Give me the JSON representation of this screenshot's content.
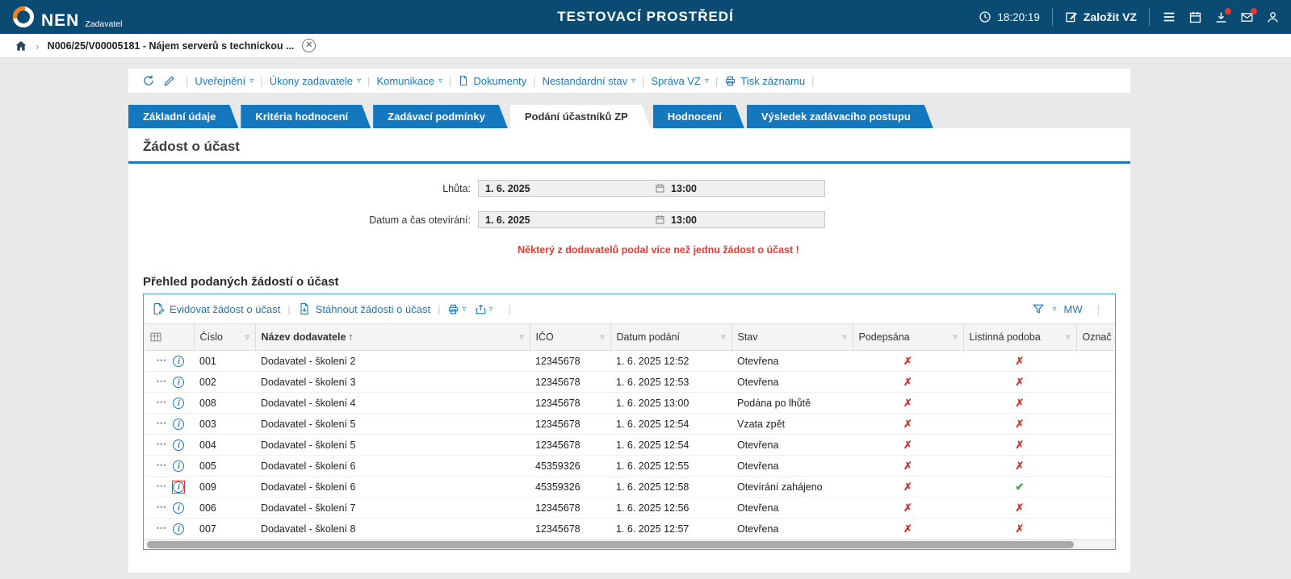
{
  "colors": {
    "header-bg": "#0a4b74",
    "tab-blue": "#1478be",
    "link-blue": "#1b78c2",
    "warning-red": "#e23b32",
    "mark-red": "#d23430",
    "mark-green": "#3fae49",
    "panel-border": "#44a2d9",
    "badge-red": "#e53935"
  },
  "icons": {
    "logo": "orange-white-ring",
    "clock-icon": "🕐",
    "create-vz-icon": "✎▢",
    "menu-icon": "≡",
    "calendar-icon": "▦",
    "download-icon": "⤓",
    "mail-icon": "✉",
    "user-icon": "👤",
    "home-icon": "⌂",
    "close-icon": "⊗",
    "refresh-icon": "⟲",
    "pencil-icon": "✎",
    "document-icon": "🗎",
    "printer-icon": "⎙",
    "export-icon": "↥",
    "filter-icon": "▼",
    "caret": "▿",
    "sort-asc": "↑",
    "row-menu-icon": "•••",
    "info-icon": "ⓘ",
    "cross-mark": "✗",
    "check-mark": "✔"
  },
  "header": {
    "brand": "NEN",
    "role": "Zadavatel",
    "title": "TESTOVACÍ PROSTŘEDÍ",
    "time": "18:20:19",
    "create_vz_label": "Založit VZ"
  },
  "breadcrumb": {
    "chevron": "›",
    "record": "N006/25/V00005181 - Nájem serverů s technickou ...",
    "close": "✕"
  },
  "record_toolbar": {
    "items": [
      {
        "label": "Uveřejnění"
      },
      {
        "label": "Úkony zadavatele"
      },
      {
        "label": "Komunikace"
      },
      {
        "label": "Dokumenty"
      },
      {
        "label": "Nestandardní stav"
      },
      {
        "label": "Správa VZ"
      },
      {
        "label": "Tisk záznamu"
      }
    ]
  },
  "tabs": [
    {
      "label": "Základní údaje",
      "active": false
    },
    {
      "label": "Kritéria hodnocení",
      "active": false
    },
    {
      "label": "Zadávací podmínky",
      "active": false
    },
    {
      "label": "Podání účastníků ZP",
      "active": true
    },
    {
      "label": "Hodnocení",
      "active": false
    },
    {
      "label": "Výsledek zadávacího postupu",
      "active": false
    }
  ],
  "request_section": {
    "title": "Žádost o účast",
    "fields": [
      {
        "label": "Lhůta:",
        "date": "1. 6. 2025",
        "time": "13:00"
      },
      {
        "label": "Datum a čas otevírání:",
        "date": "1. 6. 2025",
        "time": "13:00"
      }
    ],
    "warning": "Některý z dodavatelů podal více než jednu žádost o účast !"
  },
  "grid": {
    "title": "Přehled podaných žádostí o účast",
    "toolbar": {
      "evidovat": "Evidovat žádost o účast",
      "stahnout": "Stáhnout žádosti o účast",
      "mw": "MW"
    },
    "columns": {
      "cislo": "Číslo",
      "nazev": "Název dodavatele",
      "ico": "IČO",
      "datum": "Datum podání",
      "stav": "Stav",
      "podepsana": "Podepsána",
      "listinna": "Listinná podoba",
      "oznac": "Označ"
    },
    "rows": [
      {
        "cislo": "001",
        "nazev": "Dodavatel - školení 2",
        "ico": "12345678",
        "datum": "1. 6. 2025 12:52",
        "stav": "Otevřena",
        "podepsana": false,
        "listinna": false,
        "info_highlighted": false
      },
      {
        "cislo": "002",
        "nazev": "Dodavatel - školení 3",
        "ico": "12345678",
        "datum": "1. 6. 2025 12:53",
        "stav": "Otevřena",
        "podepsana": false,
        "listinna": false,
        "info_highlighted": false
      },
      {
        "cislo": "008",
        "nazev": "Dodavatel - školení 4",
        "ico": "12345678",
        "datum": "1. 6. 2025 13:00",
        "stav": "Podána po lhůtě",
        "podepsana": false,
        "listinna": false,
        "info_highlighted": false
      },
      {
        "cislo": "003",
        "nazev": "Dodavatel - školení 5",
        "ico": "12345678",
        "datum": "1. 6. 2025 12:54",
        "stav": "Vzata zpět",
        "podepsana": false,
        "listinna": false,
        "info_highlighted": false
      },
      {
        "cislo": "004",
        "nazev": "Dodavatel - školení 5",
        "ico": "12345678",
        "datum": "1. 6. 2025 12:54",
        "stav": "Otevřena",
        "podepsana": false,
        "listinna": false,
        "info_highlighted": false
      },
      {
        "cislo": "005",
        "nazev": "Dodavatel - školení 6",
        "ico": "45359326",
        "datum": "1. 6. 2025 12:55",
        "stav": "Otevřena",
        "podepsana": false,
        "listinna": false,
        "info_highlighted": false
      },
      {
        "cislo": "009",
        "nazev": "Dodavatel - školení 6",
        "ico": "45359326",
        "datum": "1. 6. 2025 12:58",
        "stav": "Otevírání zahájeno",
        "podepsana": false,
        "listinna": true,
        "info_highlighted": true
      },
      {
        "cislo": "006",
        "nazev": "Dodavatel - školení 7",
        "ico": "12345678",
        "datum": "1. 6. 2025 12:56",
        "stav": "Otevřena",
        "podepsana": false,
        "listinna": false,
        "info_highlighted": false
      },
      {
        "cislo": "007",
        "nazev": "Dodavatel - školení 8",
        "ico": "12345678",
        "datum": "1. 6. 2025 12:57",
        "stav": "Otevřena",
        "podepsana": false,
        "listinna": false,
        "info_highlighted": false
      }
    ]
  }
}
